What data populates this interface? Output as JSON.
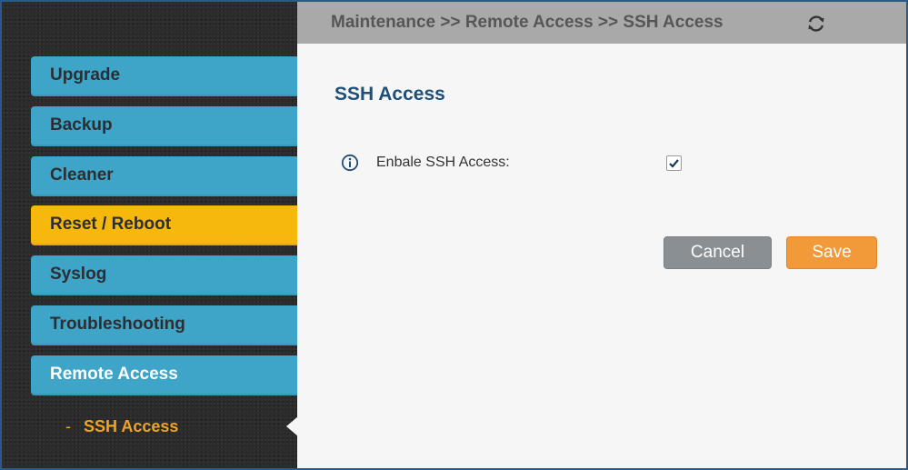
{
  "sidebar": {
    "items": [
      {
        "label": "Upgrade"
      },
      {
        "label": "Backup"
      },
      {
        "label": "Cleaner"
      },
      {
        "label": "Reset / Reboot"
      },
      {
        "label": "Syslog"
      },
      {
        "label": "Troubleshooting"
      },
      {
        "label": "Remote Access"
      }
    ],
    "sub_item": {
      "dash": "-",
      "label": "SSH Access"
    }
  },
  "header": {
    "breadcrumb": "Maintenance >> Remote Access >> SSH Access"
  },
  "main": {
    "title": "SSH Access",
    "field": {
      "label": "Enbale SSH Access:",
      "checked": true
    },
    "cancel_label": "Cancel",
    "save_label": "Save"
  },
  "icons": {
    "refresh": "refresh-icon",
    "info": "info-icon",
    "check": "checkmark-icon"
  },
  "colors": {
    "nav_item": "#3fa5c8",
    "nav_active": "#f7b80d",
    "sub_item": "#f0a323",
    "title": "#1f4e79",
    "save": "#f29a3a",
    "cancel": "#8a8f93"
  }
}
